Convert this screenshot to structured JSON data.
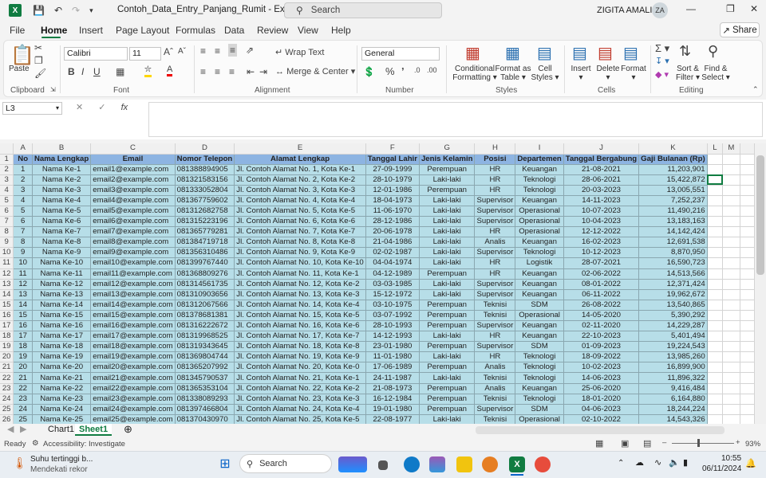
{
  "title_bar": {
    "doc_title": "Contoh_Data_Entry_Panjang_Rumit  -  Excel",
    "search_placeholder": "Search",
    "user_name": "ZIGITA AMALIA",
    "user_initials": "ZA"
  },
  "menu": [
    "File",
    "Home",
    "Insert",
    "Page Layout",
    "Formulas",
    "Data",
    "Review",
    "View",
    "Help"
  ],
  "share_label": "Share",
  "ribbon": {
    "clipboard": {
      "paste": "Paste",
      "group": "Clipboard"
    },
    "font": {
      "name": "Calibri",
      "size": "11",
      "group": "Font"
    },
    "alignment": {
      "wrap": "Wrap Text",
      "merge": "Merge & Center",
      "group": "Alignment"
    },
    "number": {
      "format": "General",
      "group": "Number"
    },
    "styles": {
      "cond1": "Conditional",
      "cond2": "Formatting",
      "fmt1": "Format as",
      "fmt2": "Table",
      "cell1": "Cell",
      "cell2": "Styles",
      "group": "Styles"
    },
    "cells": {
      "insert": "Insert",
      "delete": "Delete",
      "format": "Format",
      "group": "Cells"
    },
    "editing": {
      "sort1": "Sort &",
      "sort2": "Filter",
      "find1": "Find &",
      "find2": "Select",
      "group": "Editing"
    }
  },
  "name_box": "L3",
  "columns": [
    "A",
    "B",
    "C",
    "D",
    "E",
    "F",
    "G",
    "H",
    "I",
    "J",
    "K",
    "L",
    "M"
  ],
  "headers": [
    "No",
    "Nama Lengkap",
    "Email",
    "Nomor Telepon",
    "Alamat Lengkap",
    "Tanggal Lahir",
    "Jenis Kelamin",
    "Posisi",
    "Departemen",
    "Tanggal Bergabung",
    "Gaji Bulanan (Rp)"
  ],
  "rows": [
    [
      "1",
      "Nama Ke-1",
      "email1@example.com",
      "081388894905",
      "Jl. Contoh Alamat No. 1, Kota Ke-1",
      "27-09-1999",
      "Perempuan",
      "HR",
      "Keuangan",
      "21-08-2021",
      "11,203,901"
    ],
    [
      "2",
      "Nama Ke-2",
      "email2@example.com",
      "081321583156",
      "Jl. Contoh Alamat No. 2, Kota Ke-2",
      "28-10-1979",
      "Laki-laki",
      "HR",
      "Teknologi",
      "28-06-2021",
      "15,422,872"
    ],
    [
      "3",
      "Nama Ke-3",
      "email3@example.com",
      "081333052804",
      "Jl. Contoh Alamat No. 3, Kota Ke-3",
      "12-01-1986",
      "Perempuan",
      "HR",
      "Teknologi",
      "20-03-2023",
      "13,005,551"
    ],
    [
      "4",
      "Nama Ke-4",
      "email4@example.com",
      "081367759602",
      "Jl. Contoh Alamat No. 4, Kota Ke-4",
      "18-04-1973",
      "Laki-laki",
      "Supervisor",
      "Keuangan",
      "14-11-2023",
      "7,252,237"
    ],
    [
      "5",
      "Nama Ke-5",
      "email5@example.com",
      "081312682758",
      "Jl. Contoh Alamat No. 5, Kota Ke-5",
      "11-06-1970",
      "Laki-laki",
      "Supervisor",
      "Operasional",
      "10-07-2023",
      "11,490,216"
    ],
    [
      "6",
      "Nama Ke-6",
      "email6@example.com",
      "081315223196",
      "Jl. Contoh Alamat No. 6, Kota Ke-6",
      "28-12-1986",
      "Laki-laki",
      "Supervisor",
      "Operasional",
      "10-04-2023",
      "13,183,163"
    ],
    [
      "7",
      "Nama Ke-7",
      "email7@example.com",
      "081365779281",
      "Jl. Contoh Alamat No. 7, Kota Ke-7",
      "20-06-1978",
      "Laki-laki",
      "HR",
      "Operasional",
      "12-12-2022",
      "14,142,424"
    ],
    [
      "8",
      "Nama Ke-8",
      "email8@example.com",
      "081384719718",
      "Jl. Contoh Alamat No. 8, Kota Ke-8",
      "21-04-1986",
      "Laki-laki",
      "Analis",
      "Keuangan",
      "16-02-2023",
      "12,691,538"
    ],
    [
      "9",
      "Nama Ke-9",
      "email9@example.com",
      "081356310486",
      "Jl. Contoh Alamat No. 9, Kota Ke-9",
      "02-02-1987",
      "Laki-laki",
      "Supervisor",
      "Teknologi",
      "10-12-2023",
      "8,870,950"
    ],
    [
      "10",
      "Nama Ke-10",
      "email10@example.com",
      "081399767440",
      "Jl. Contoh Alamat No. 10, Kota Ke-10",
      "04-04-1974",
      "Laki-laki",
      "HR",
      "Logistik",
      "28-07-2021",
      "16,590,723"
    ],
    [
      "11",
      "Nama Ke-11",
      "email11@example.com",
      "081368809276",
      "Jl. Contoh Alamat No. 11, Kota Ke-1",
      "04-12-1989",
      "Perempuan",
      "HR",
      "Keuangan",
      "02-06-2022",
      "14,513,566"
    ],
    [
      "12",
      "Nama Ke-12",
      "email12@example.com",
      "081314561735",
      "Jl. Contoh Alamat No. 12, Kota Ke-2",
      "03-03-1985",
      "Laki-laki",
      "Supervisor",
      "Keuangan",
      "08-01-2022",
      "12,371,424"
    ],
    [
      "13",
      "Nama Ke-13",
      "email13@example.com",
      "081310903656",
      "Jl. Contoh Alamat No. 13, Kota Ke-3",
      "15-12-1972",
      "Laki-laki",
      "Supervisor",
      "Keuangan",
      "06-11-2022",
      "19,962,672"
    ],
    [
      "14",
      "Nama Ke-14",
      "email14@example.com",
      "081312067566",
      "Jl. Contoh Alamat No. 14, Kota Ke-4",
      "03-10-1975",
      "Perempuan",
      "Teknisi",
      "SDM",
      "26-08-2022",
      "13,540,865"
    ],
    [
      "15",
      "Nama Ke-15",
      "email15@example.com",
      "081378681381",
      "Jl. Contoh Alamat No. 15, Kota Ke-5",
      "03-07-1992",
      "Perempuan",
      "Teknisi",
      "Operasional",
      "14-05-2020",
      "5,390,292"
    ],
    [
      "16",
      "Nama Ke-16",
      "email16@example.com",
      "081316222672",
      "Jl. Contoh Alamat No. 16, Kota Ke-6",
      "28-10-1993",
      "Perempuan",
      "Supervisor",
      "Keuangan",
      "02-11-2020",
      "14,229,287"
    ],
    [
      "17",
      "Nama Ke-17",
      "email17@example.com",
      "081319968525",
      "Jl. Contoh Alamat No. 17, Kota Ke-7",
      "14-12-1993",
      "Laki-laki",
      "HR",
      "Keuangan",
      "22-10-2023",
      "5,401,494"
    ],
    [
      "18",
      "Nama Ke-18",
      "email18@example.com",
      "081319343645",
      "Jl. Contoh Alamat No. 18, Kota Ke-8",
      "23-01-1980",
      "Perempuan",
      "Supervisor",
      "SDM",
      "01-09-2023",
      "19,224,543"
    ],
    [
      "19",
      "Nama Ke-19",
      "email19@example.com",
      "081369804744",
      "Jl. Contoh Alamat No. 19, Kota Ke-9",
      "11-01-1980",
      "Laki-laki",
      "HR",
      "Teknologi",
      "18-09-2022",
      "13,985,260"
    ],
    [
      "20",
      "Nama Ke-20",
      "email20@example.com",
      "081365207992",
      "Jl. Contoh Alamat No. 20, Kota Ke-0",
      "17-06-1989",
      "Perempuan",
      "Analis",
      "Teknologi",
      "10-02-2023",
      "16,899,900"
    ],
    [
      "21",
      "Nama Ke-21",
      "email21@example.com",
      "081345790537",
      "Jl. Contoh Alamat No. 21, Kota Ke-1",
      "24-11-1987",
      "Laki-laki",
      "Teknisi",
      "Teknologi",
      "14-06-2023",
      "11,896,322"
    ],
    [
      "22",
      "Nama Ke-22",
      "email22@example.com",
      "081365353104",
      "Jl. Contoh Alamat No. 22, Kota Ke-2",
      "21-08-1973",
      "Perempuan",
      "Analis",
      "Keuangan",
      "25-06-2020",
      "9,416,484"
    ],
    [
      "23",
      "Nama Ke-23",
      "email23@example.com",
      "081338089293",
      "Jl. Contoh Alamat No. 23, Kota Ke-3",
      "16-12-1984",
      "Perempuan",
      "Teknisi",
      "Teknologi",
      "18-01-2020",
      "6,164,880"
    ],
    [
      "24",
      "Nama Ke-24",
      "email24@example.com",
      "081397466804",
      "Jl. Contoh Alamat No. 24, Kota Ke-4",
      "19-01-1980",
      "Perempuan",
      "Supervisor",
      "SDM",
      "04-06-2023",
      "18,244,224"
    ],
    [
      "25",
      "Nama Ke-25",
      "email25@example.com",
      "081370430970",
      "Jl. Contoh Alamat No. 25, Kota Ke-5",
      "22-08-1977",
      "Laki-laki",
      "Teknisi",
      "Operasional",
      "02-10-2022",
      "14,543,326"
    ]
  ],
  "sheets": [
    "Chart1",
    "Sheet1"
  ],
  "status": {
    "ready": "Ready",
    "accessibility": "Accessibility: Investigate",
    "zoom": "93%"
  },
  "taskbar": {
    "weather_title": "Suhu tertinggi b...",
    "weather_sub": "Mendekati rekor",
    "search": "Search",
    "time": "10:55",
    "date": "06/11/2024"
  },
  "colors": {
    "excel_green": "#107c41",
    "header_fill": "#8db4e2",
    "data_fill": "#b7dee8"
  }
}
